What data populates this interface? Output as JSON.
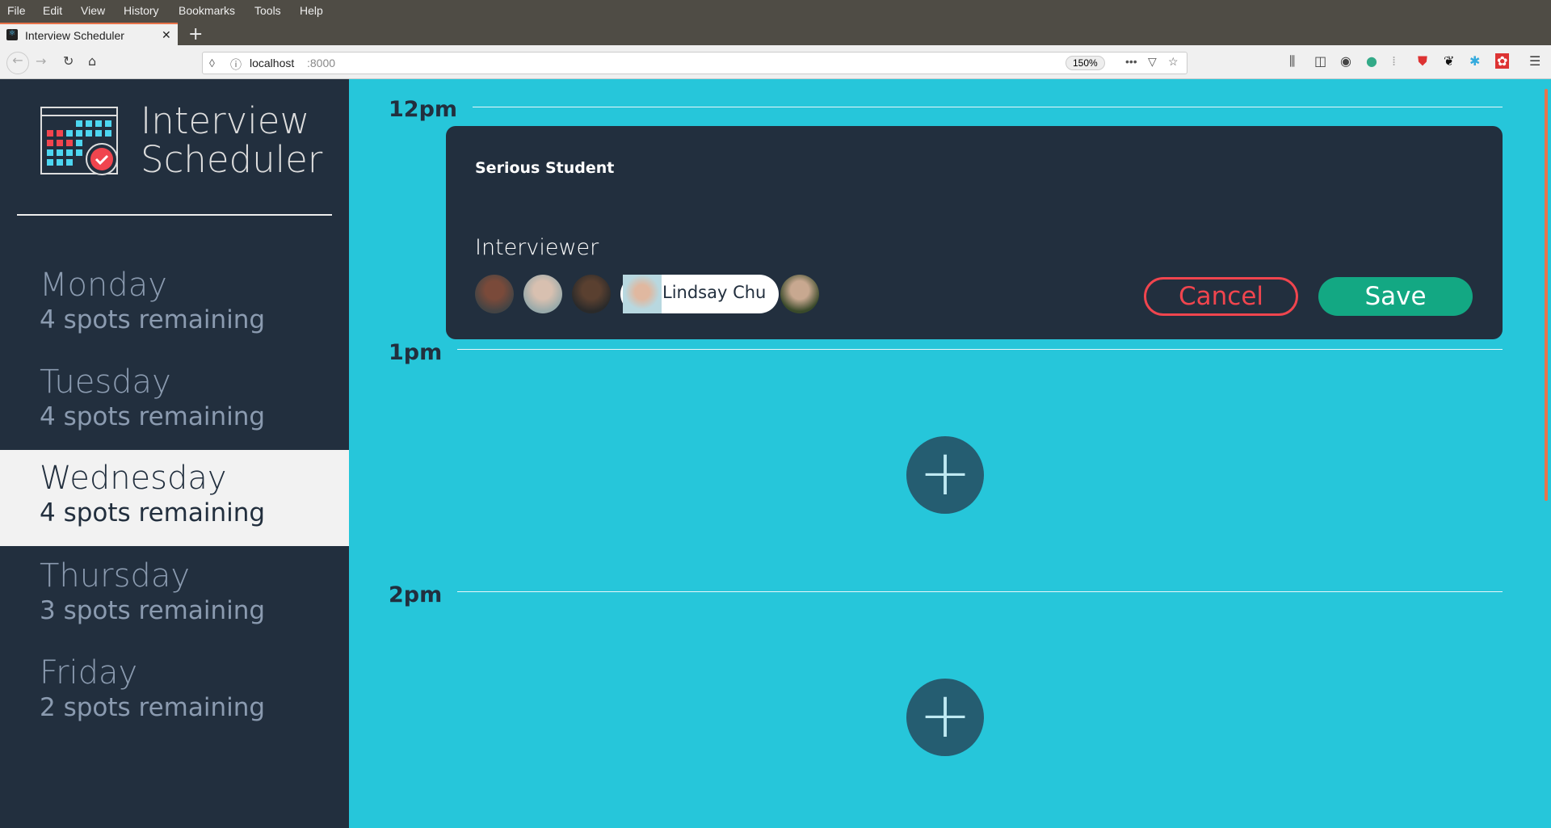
{
  "browser": {
    "menu": [
      "File",
      "Edit",
      "View",
      "History",
      "Bookmarks",
      "Tools",
      "Help"
    ],
    "tab_title": "Interview Scheduler",
    "url_host": "localhost",
    "url_port": ":8000",
    "zoom": "150%"
  },
  "app": {
    "title_line1": "Interview",
    "title_line2": "Scheduler"
  },
  "days": [
    {
      "name": "Monday",
      "spots": "4 spots remaining"
    },
    {
      "name": "Tuesday",
      "spots": "4 spots remaining"
    },
    {
      "name": "Wednesday",
      "spots": "4 spots remaining",
      "selected": true
    },
    {
      "name": "Thursday",
      "spots": "3 spots remaining"
    },
    {
      "name": "Friday",
      "spots": "2 spots remaining"
    }
  ],
  "schedule": {
    "times": [
      "12pm",
      "1pm",
      "2pm"
    ]
  },
  "form": {
    "student_name": "Serious Student",
    "interviewer_label": "Interviewer",
    "selected_interviewer": "Lindsay Chu",
    "cancel": "Cancel",
    "save": "Save"
  },
  "colors": {
    "sidebar": "#222f3e",
    "main": "#26c6da",
    "save": "#13a883",
    "cancel": "#f0454e",
    "add": "#255d71"
  }
}
